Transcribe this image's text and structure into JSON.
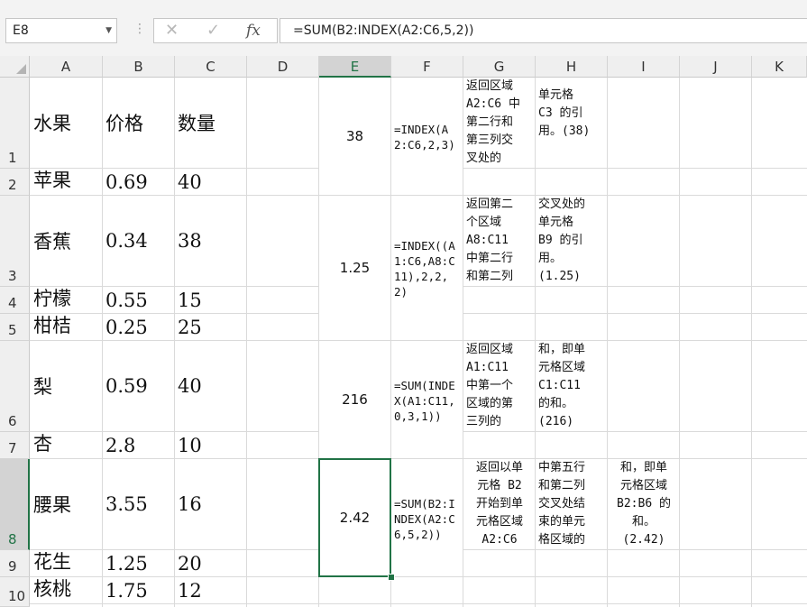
{
  "name_box": {
    "value": "E8"
  },
  "formula_bar": {
    "cancel_icon": "✕",
    "enter_icon": "✓",
    "fx_label": "fx",
    "formula": "=SUM(B2:INDEX(A2:C6,5,2))"
  },
  "columns": [
    "A",
    "B",
    "C",
    "D",
    "E",
    "F",
    "G",
    "H",
    "I",
    "J",
    "K"
  ],
  "rows": [
    "1",
    "2",
    "3",
    "4",
    "5",
    "6",
    "7",
    "8",
    "9",
    "10"
  ],
  "cells": {
    "A1": "水果",
    "B1": "价格",
    "C1": "数量",
    "A2": "苹果",
    "B2": "0.69",
    "C2": "40",
    "A3": "香蕉",
    "B3": "0.34",
    "C3": "38",
    "A4": "柠檬",
    "B4": "0.55",
    "C4": "15",
    "A5": "柑桔",
    "B5": "0.25",
    "C5": "25",
    "A6": "梨",
    "B6": "0.59",
    "C6": "40",
    "A7": "杏",
    "B7": "2.8",
    "C7": "10",
    "A8": "腰果",
    "B8": "3.55",
    "C8": "16",
    "A9": "花生",
    "B9": "1.25",
    "C9": "20",
    "A10": "核桃",
    "B10": "1.75",
    "C10": "12"
  },
  "examples": [
    {
      "result": "38",
      "formula": "=INDEX(A2:C6,2,3)",
      "desc1": "返回区域\nA2:C6 中\n第二行和\n第三列交\n叉处的",
      "desc2": "单元格\nC3 的引\n用。(38)"
    },
    {
      "result": "1.25",
      "formula": "=INDEX((A1:C6,A8:C11),2,2,2)",
      "desc1": "返回第二\n个区域\nA8:C11\n中第二行\n和第二列",
      "desc2": "交叉处的\n单元格\nB9 的引\n用。\n(1.25)"
    },
    {
      "result": "216",
      "formula": "=SUM(INDEX(A1:C11,0,3,1))",
      "desc1": "返回区域\nA1:C11\n中第一个\n区域的第\n三列的",
      "desc2": "和，即单\n元格区域\nC1:C11\n的和。\n(216)"
    },
    {
      "result": "2.42",
      "formula": "=SUM(B2:INDEX(A2:C6,5,2))",
      "desc1": "返回以单\n元格 B2\n开始到单\n元格区域\nA2:C6",
      "desc2": "中第五行\n和第二列\n交叉处结\n束的单元\n格区域的",
      "desc3": "和，即单\n元格区域\nB2:B6 的\n和。\n(2.42)"
    }
  ],
  "selection": {
    "active_cell": "E8",
    "accent": "#217346"
  }
}
